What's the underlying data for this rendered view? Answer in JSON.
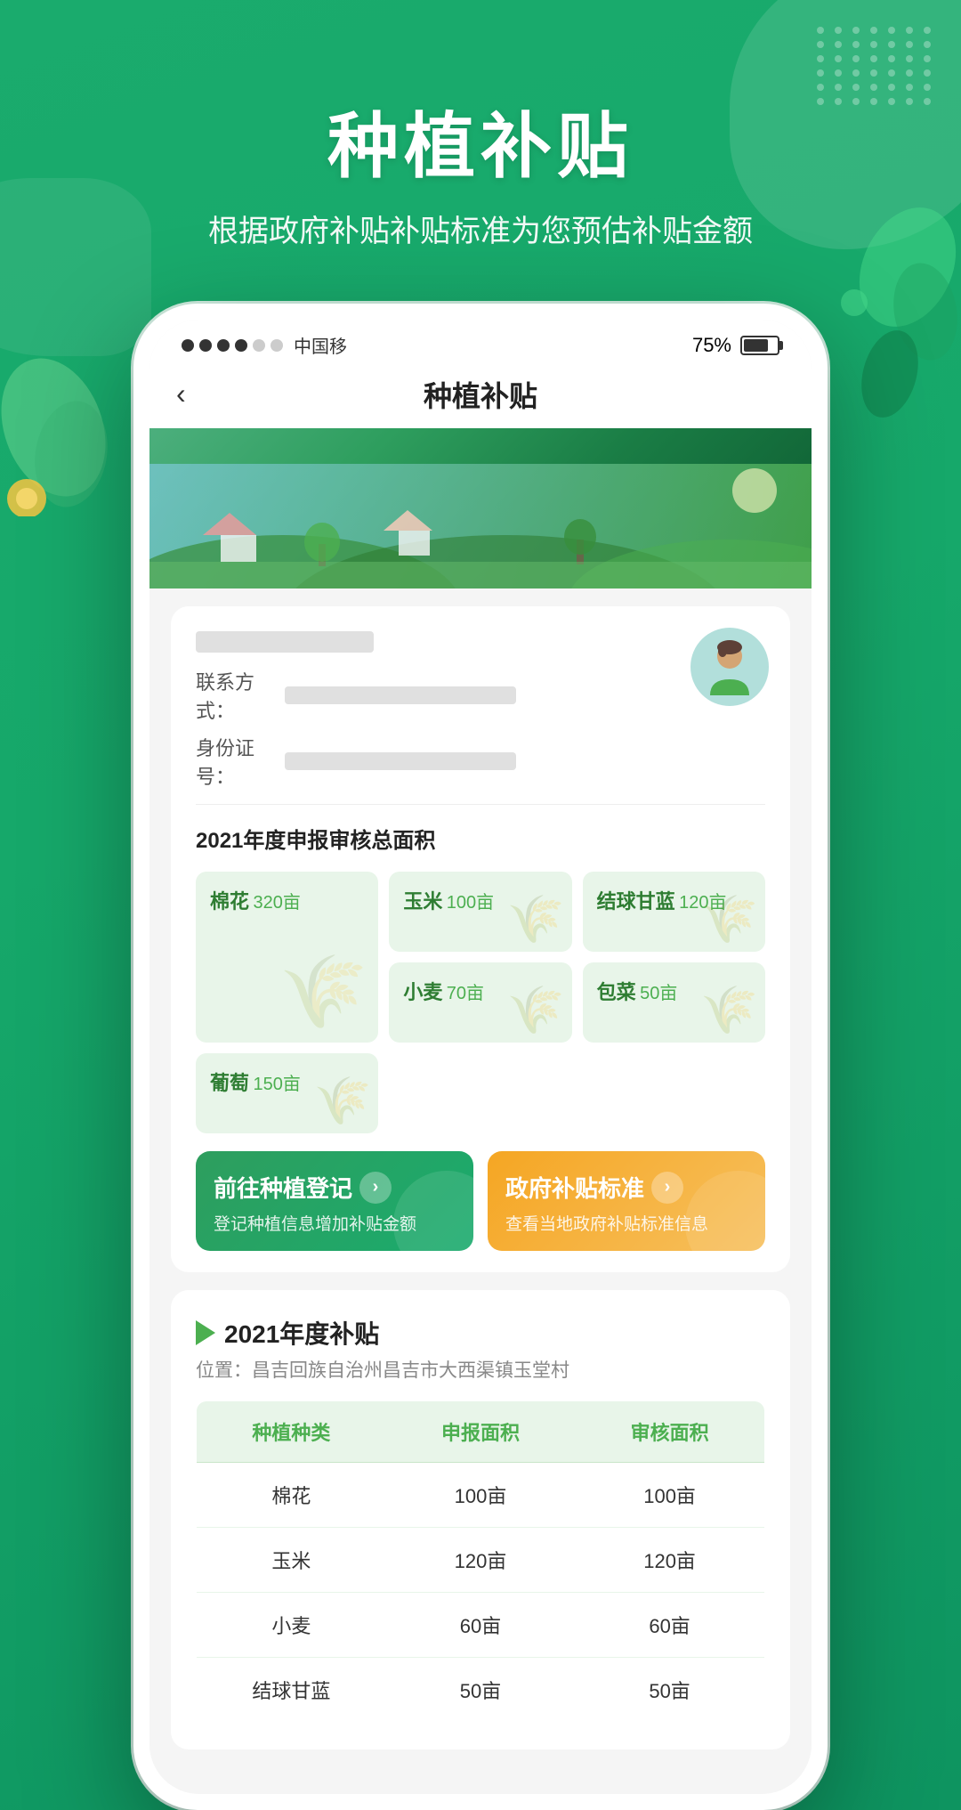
{
  "app": {
    "main_title": "种植补贴",
    "sub_title": "根据政府补贴补贴标准为您预估补贴金额"
  },
  "status_bar": {
    "carrier": "中国移",
    "battery": "75%",
    "signal_dots": [
      true,
      true,
      true,
      true,
      false,
      false
    ]
  },
  "nav": {
    "back_label": "‹",
    "title": "种植补贴"
  },
  "user_card": {
    "contact_label": "联系方式：",
    "id_label": "身份证号："
  },
  "crop_stats": {
    "section_title": "2021年度申报审核总面积",
    "crops": [
      {
        "name": "棉花",
        "area": "320亩",
        "large": true
      },
      {
        "name": "玉米",
        "area": "100亩",
        "large": false
      },
      {
        "name": "结球甘蓝",
        "area": "120亩",
        "large": false
      },
      {
        "name": "小麦",
        "area": "70亩",
        "large": false
      },
      {
        "name": "包菜",
        "area": "50亩",
        "large": false
      },
      {
        "name": "葡萄",
        "area": "150亩",
        "large": false
      }
    ]
  },
  "action_buttons": {
    "register": {
      "title": "前往种植登记",
      "icon": "›",
      "desc": "登记种植信息增加补贴金额"
    },
    "subsidy_standard": {
      "title": "政府补贴标准",
      "icon": "›",
      "desc": "查看当地政府补贴标准信息"
    }
  },
  "subsidy_section": {
    "title": "2021年度补贴",
    "location_label": "位置：",
    "location": "昌吉回族自治州昌吉市大西渠镇玉堂村",
    "table": {
      "headers": [
        "种植种类",
        "申报面积",
        "审核面积"
      ],
      "rows": [
        {
          "crop": "棉花",
          "declared": "100亩",
          "approved": "100亩"
        },
        {
          "crop": "玉米",
          "declared": "120亩",
          "approved": "120亩"
        },
        {
          "crop": "小麦",
          "declared": "60亩",
          "approved": "60亩"
        },
        {
          "crop": "结球甘蓝",
          "declared": "50亩",
          "approved": "50亩"
        }
      ]
    }
  }
}
